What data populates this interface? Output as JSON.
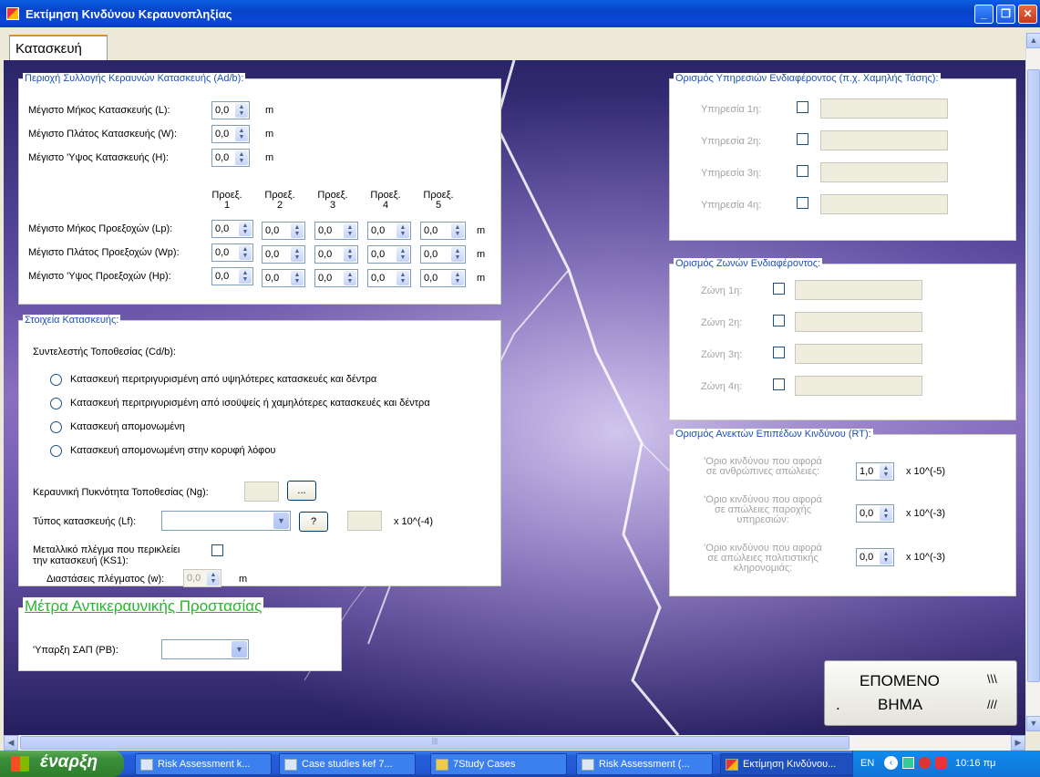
{
  "window": {
    "title": "Εκτίμηση Κινδύνου Κεραυνοπληξίας"
  },
  "tab": {
    "label": "Κατασκευή"
  },
  "collection": {
    "legend": "Περιοχή Συλλογής Κεραυνών Κατασκευής (Ad/b):",
    "rows": [
      {
        "label": "Μέγιστο Μήκος Κατασκευής (L):",
        "value": "0,0",
        "unit": "m"
      },
      {
        "label": "Μέγιστο Πλάτος Κατασκευής (W):",
        "value": "0,0",
        "unit": "m"
      },
      {
        "label": "Μέγιστο 'Υψος Κατασκευής (H):",
        "value": "0,0",
        "unit": "m"
      }
    ],
    "proj_headers": [
      [
        "Προεξ.",
        "1"
      ],
      [
        "Προεξ.",
        "2"
      ],
      [
        "Προεξ.",
        "3"
      ],
      [
        "Προεξ.",
        "4"
      ],
      [
        "Προεξ.",
        "5"
      ]
    ],
    "proj_rows": [
      {
        "label": "Μέγιστο Μήκος Προεξοχών (Lp):",
        "values": [
          "0,0",
          "0,0",
          "0,0",
          "0,0",
          "0,0"
        ],
        "unit": "m"
      },
      {
        "label": "Μέγιστο Πλάτος Προεξοχών (Wp):",
        "values": [
          "0,0",
          "0,0",
          "0,0",
          "0,0",
          "0,0"
        ],
        "unit": "m"
      },
      {
        "label": "Μέγιστο 'Υψος Προεξοχών (Hp):",
        "values": [
          "0,0",
          "0,0",
          "0,0",
          "0,0",
          "0,0"
        ],
        "unit": "m"
      }
    ]
  },
  "construction": {
    "legend": "Στοιχεία Κατασκευής:",
    "coeff_label": "Συντελεστής Τοποθεσίας (Cd/b):",
    "options": [
      "Κατασκευή περιτριγυρισμένη από υψηλότερες κατασκευές και δέντρα",
      "Κατασκευή περιτριγυρισμένη από ισοϋψείς ή χαμηλότερες κατασκευές και δέντρα",
      "Κατασκευή απομονωμένη",
      "Κατασκευή απομονωμένη στην κορυφή λόφου"
    ],
    "density_label": "Κεραυνική Πυκνότητα Τοποθεσίας (Ng):",
    "browse_label": "...",
    "type_label": "Τύπος κατασκευής (Lf):",
    "help_label": "?",
    "type_unit": "x 10^(-4)",
    "mesh_label_1": "Μεταλλικό πλέγμα που περικλείει",
    "mesh_label_2": "την κατασκευή (KS1):",
    "mesh_dim_label": "Διαστάσεις πλέγματος (w):",
    "mesh_dim_value": "0,0",
    "mesh_dim_unit": "m"
  },
  "protection": {
    "legend": "Μέτρα Αντικεραυνικής Προστασίας",
    "sap_label": "'Υπαρξη ΣΑΠ (PB):"
  },
  "services": {
    "legend": "Ορισμός Υπηρεσιών Ενδιαφέροντος (π.χ. Χαμηλής Τάσης):",
    "items": [
      "Υπηρεσία 1η:",
      "Υπηρεσία 2η:",
      "Υπηρεσία 3η:",
      "Υπηρεσία 4η:"
    ]
  },
  "zones": {
    "legend": "Ορισμός Ζωνών Ενδιαφέροντος:",
    "items": [
      "Ζώνη 1η:",
      "Ζώνη 2η:",
      "Ζώνη 3η:",
      "Ζώνη 4η:"
    ]
  },
  "risk": {
    "legend": "Ορισμός Ανεκτών Επιπέδων Κινδύνου (RT):",
    "rows": [
      {
        "lines": [
          "'Οριο κινδύνου που αφορά",
          "σε ανθρώπινες απώλειες:"
        ],
        "value": "1,0",
        "unit": "x 10^(-5)"
      },
      {
        "lines": [
          "'Οριο κινδύνου που αφορά",
          "σε απώλειες παροχής",
          "υπηρεσιών:"
        ],
        "value": "0,0",
        "unit": "x 10^(-3)"
      },
      {
        "lines": [
          "'Οριο κινδύνου που αφορά",
          "σε απώλειες πολιτιστικής",
          "κληρονομιάς:"
        ],
        "value": "0,0",
        "unit": "x 10^(-3)"
      }
    ]
  },
  "next": {
    "line1": "ΕΠΟΜΕΝΟ",
    "line2": "ΒΗΜΑ",
    "mark1": "\\\\\\",
    "mark2": "///",
    "dot": "."
  },
  "taskbar": {
    "start": "έναρξη",
    "tasks": [
      "Risk Assessment  k...",
      "Case studies kef 7...",
      "7Study Cases",
      "Risk Assessment (...",
      "Εκτίμηση Κινδύνου..."
    ],
    "lang": "EN",
    "clock": "10:16 πμ"
  }
}
